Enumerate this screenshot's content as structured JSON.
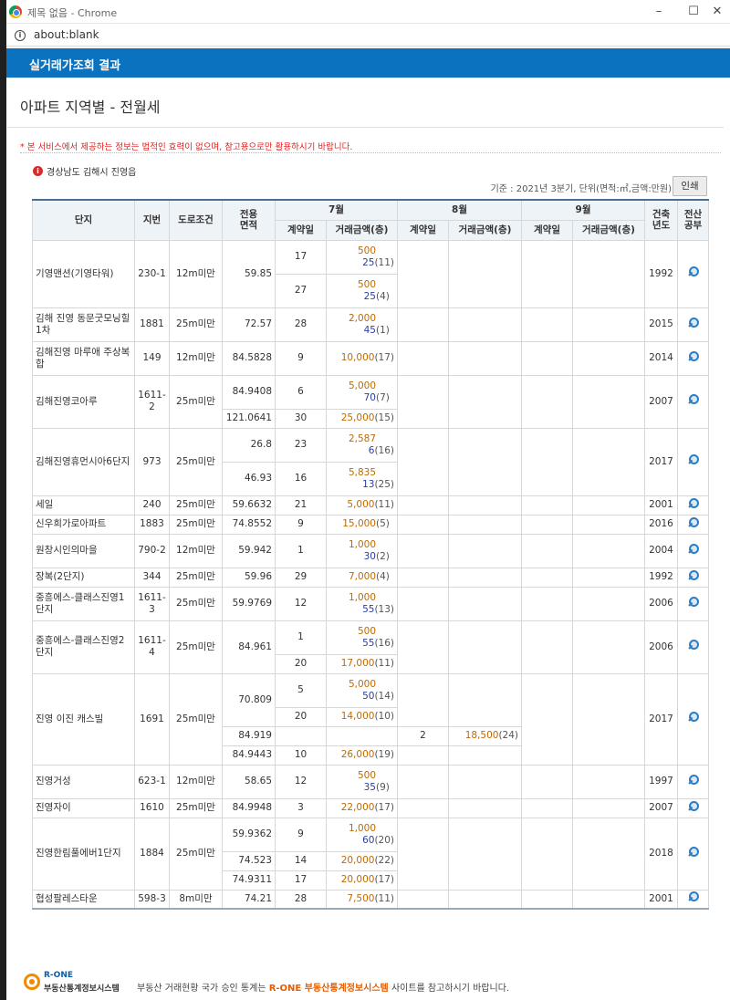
{
  "window": {
    "title": "제목 없음 - Chrome",
    "url": "about:blank"
  },
  "header": {
    "bar_title": "실거래가조회 결과",
    "page_title": "아파트 지역별 - 전월세"
  },
  "disclaimer": "* 본 서비스에서 제공하는 정보는 법적인 효력이 없으며, 참고용으로만 활용하시기 바랍니다.",
  "region": "경상남도 김해시 진영읍",
  "basis": "기준 : 2021년 3분기, 단위(면적:㎡,금액:만원)",
  "print_label": "인쇄",
  "columns": {
    "complex": "단지",
    "lot": "지번",
    "road": "도로조건",
    "area1": "전용",
    "area2": "면적",
    "month7": "7월",
    "month8": "8월",
    "month9": "9월",
    "day": "계약일",
    "amount": "거래금액(층)",
    "built1": "건축",
    "built2": "년도",
    "reg1": "전산",
    "reg2": "공부"
  },
  "rows": [
    {
      "name": "기영맨션(기영타워)",
      "lot": "230-1",
      "road": "12m미만",
      "area": "59.85",
      "built": "1992",
      "deals": [
        {
          "day": "17",
          "dep": "500",
          "mon": "25",
          "cnt": "(11)"
        },
        {
          "day": "27",
          "dep": "500",
          "mon": "25",
          "cnt": "(4)"
        }
      ]
    },
    {
      "name": "김해 진영 동문굿모닝힐 1차",
      "lot": "1881",
      "road": "25m미만",
      "area": "72.57",
      "built": "2015",
      "deals": [
        {
          "day": "28",
          "dep": "2,000",
          "mon": "45",
          "cnt": "(1)"
        }
      ]
    },
    {
      "name": "김해진영 마루애 주상복합",
      "lot": "149",
      "road": "12m미만",
      "area": "84.5828",
      "built": "2014",
      "deals": [
        {
          "day": "9",
          "dep": "10,000",
          "dep_cnt": "(17)"
        }
      ]
    },
    {
      "name": "김해진영코아루",
      "lot": "1611-2",
      "road": "25m미만",
      "built": "2007",
      "areas": [
        "84.9408",
        "121.0641"
      ],
      "deals": [
        {
          "day": "6",
          "dep": "5,000",
          "mon": "70",
          "cnt": "(7)"
        },
        {
          "day": "30",
          "dep": "25,000",
          "dep_cnt": "(15)"
        }
      ]
    },
    {
      "name": "김해진영휴먼시아6단지",
      "lot": "973",
      "road": "25m미만",
      "built": "2017",
      "areas": [
        "26.8",
        "46.93"
      ],
      "deals": [
        {
          "day": "23",
          "dep": "2,587",
          "mon": "6",
          "cnt": "(16)"
        },
        {
          "day": "16",
          "dep": "5,835",
          "mon": "13",
          "cnt": "(25)"
        }
      ]
    },
    {
      "name": "세일",
      "lot": "240",
      "road": "25m미만",
      "area": "59.6632",
      "built": "2001",
      "deals": [
        {
          "day": "21",
          "dep": "5,000",
          "dep_cnt": "(11)"
        }
      ]
    },
    {
      "name": "신우희가로아파트",
      "lot": "1883",
      "road": "25m미만",
      "area": "74.8552",
      "built": "2016",
      "deals": [
        {
          "day": "9",
          "dep": "15,000",
          "dep_cnt": "(5)"
        }
      ]
    },
    {
      "name": "원창시인의마을",
      "lot": "790-2",
      "road": "12m미만",
      "area": "59.942",
      "built": "2004",
      "deals": [
        {
          "day": "1",
          "dep": "1,000",
          "mon": "30",
          "cnt": "(2)"
        }
      ]
    },
    {
      "name": "장복(2단지)",
      "lot": "344",
      "road": "25m미만",
      "area": "59.96",
      "built": "1992",
      "deals": [
        {
          "day": "29",
          "dep": "7,000",
          "dep_cnt": "(4)"
        }
      ]
    },
    {
      "name": "중흥에스-클래스진영1단지",
      "lot": "1611-3",
      "road": "25m미만",
      "area": "59.9769",
      "built": "2006",
      "deals": [
        {
          "day": "12",
          "dep": "1,000",
          "mon": "55",
          "cnt": "(13)"
        }
      ]
    },
    {
      "name": "중흥에스-클래스진영2단지",
      "lot": "1611-4",
      "road": "25m미만",
      "area": "84.961",
      "built": "2006",
      "deals": [
        {
          "day": "1",
          "dep": "500",
          "mon": "55",
          "cnt": "(16)"
        },
        {
          "day": "20",
          "dep": "17,000",
          "dep_cnt": "(11)"
        }
      ]
    },
    {
      "name": "진영 이진 캐스빌",
      "lot": "1691",
      "road": "25m미만",
      "built": "2017",
      "areas": [
        "70.809",
        "84.919",
        "84.9443"
      ],
      "deals": [
        {
          "day": "5",
          "dep": "5,000",
          "mon": "50",
          "cnt": "(14)"
        },
        {
          "day": "20",
          "dep": "14,000",
          "dep_cnt": "(10)"
        },
        {
          "day": "10",
          "dep": "26,000",
          "dep_cnt": "(19)"
        }
      ],
      "deals_aug": [
        {
          "day": "2",
          "dep": "18,500",
          "dep_cnt": "(24)"
        }
      ]
    },
    {
      "name": "진영거성",
      "lot": "623-1",
      "road": "12m미만",
      "area": "58.65",
      "built": "1997",
      "deals": [
        {
          "day": "12",
          "dep": "500",
          "mon": "35",
          "cnt": "(9)"
        }
      ]
    },
    {
      "name": "진영자이",
      "lot": "1610",
      "road": "25m미만",
      "area": "84.9948",
      "built": "2007",
      "deals": [
        {
          "day": "3",
          "dep": "22,000",
          "dep_cnt": "(17)"
        }
      ]
    },
    {
      "name": "진영한림풀에버1단지",
      "lot": "1884",
      "road": "25m미만",
      "built": "2018",
      "areas": [
        "59.9362",
        "74.523",
        "74.9311"
      ],
      "deals": [
        {
          "day": "9",
          "dep": "1,000",
          "mon": "60",
          "cnt": "(20)"
        },
        {
          "day": "14",
          "dep": "20,000",
          "dep_cnt": "(22)"
        },
        {
          "day": "17",
          "dep": "20,000",
          "dep_cnt": "(17)"
        }
      ]
    },
    {
      "name": "협성팔레스타운",
      "lot": "598-3",
      "road": "8m미만",
      "area": "74.21",
      "built": "2001",
      "deals": [
        {
          "day": "28",
          "dep": "7,500",
          "dep_cnt": "(11)"
        }
      ]
    }
  ],
  "footer": {
    "logo_top": "R-ONE",
    "logo_bottom": "부동산통계정보시스템",
    "text_before": "부동산 거래현황 국가 승인 통계는",
    "text_highlight": "R-ONE 부동산통계정보시스템",
    "text_after": "사이트를 참고하시기 바랍니다."
  }
}
